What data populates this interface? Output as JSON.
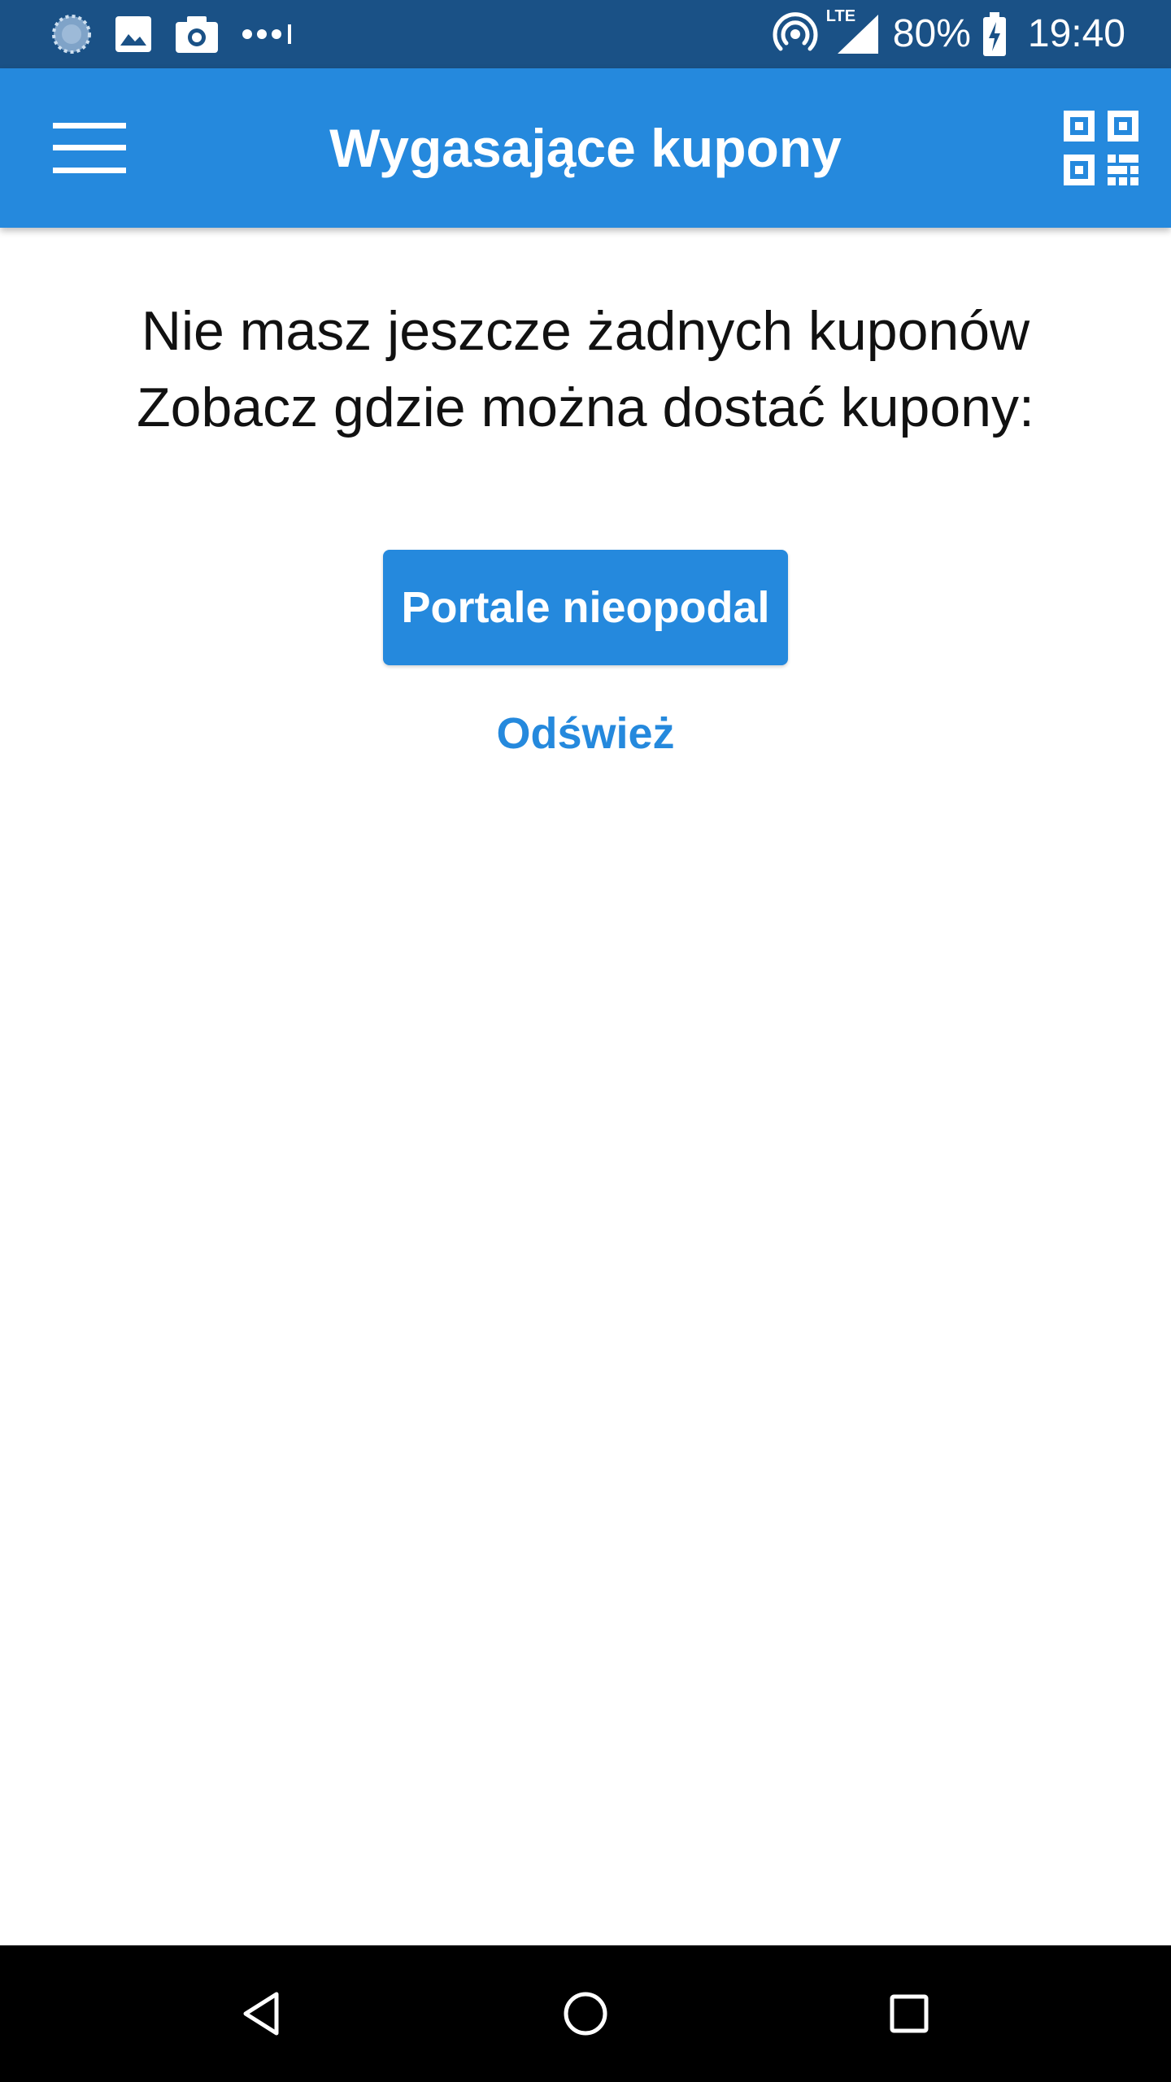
{
  "status_bar": {
    "left_icons": [
      "sync-progress-icon",
      "gallery-icon",
      "camera-icon",
      "more-notifications-icon"
    ],
    "right_icons": [
      "hotspot-icon",
      "lte-signal-icon",
      "battery-charging-icon"
    ],
    "network_label": "LTE",
    "battery": "80%",
    "time": "19:40"
  },
  "app_bar": {
    "title": "Wygasające kupony",
    "menu_icon": "hamburger-menu-icon",
    "qr_icon": "qr-code-icon",
    "background": "#2589dd"
  },
  "content": {
    "message_line1": "Nie masz jeszcze żadnych kuponów",
    "message_line2": "Zobacz gdzie można dostać kupony:",
    "primary_button": "Portale nieopodal",
    "link_button": "Odśwież"
  },
  "nav_bar": {
    "icons": [
      "back-icon",
      "home-icon",
      "recents-icon"
    ]
  },
  "colors": {
    "status_bar": "#1a5186",
    "accent": "#2589dd",
    "nav_bar": "#000000",
    "text": "#111111"
  }
}
